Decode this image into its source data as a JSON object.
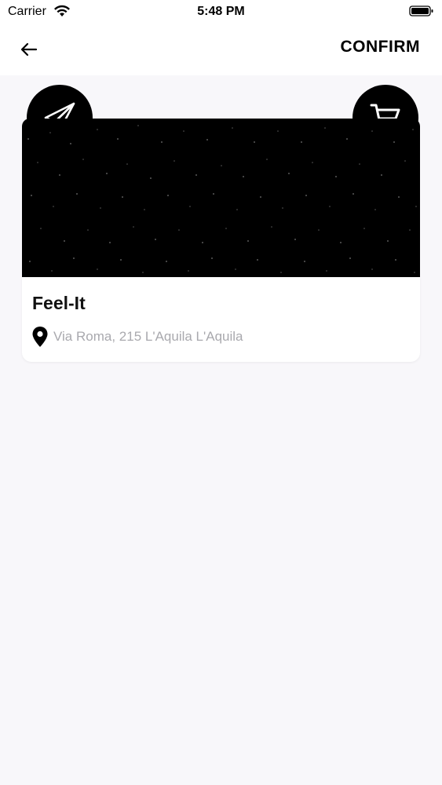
{
  "status_bar": {
    "carrier": "Carrier",
    "time": "5:48 PM",
    "wifi_icon": "wifi-icon",
    "battery_icon": "battery-icon"
  },
  "nav": {
    "back_icon": "arrow-left-icon",
    "confirm_label": "CONFIRM"
  },
  "card": {
    "title": "Feel-It",
    "address": "Via Roma, 215 L'Aquila L'Aquila",
    "left_tab_icon": "send-icon",
    "right_tab_icon": "cart-icon",
    "location_icon": "map-pin-icon"
  },
  "colors": {
    "background": "#f8f7fa",
    "card_image": "#000000",
    "address_text": "#a9a9ae"
  }
}
